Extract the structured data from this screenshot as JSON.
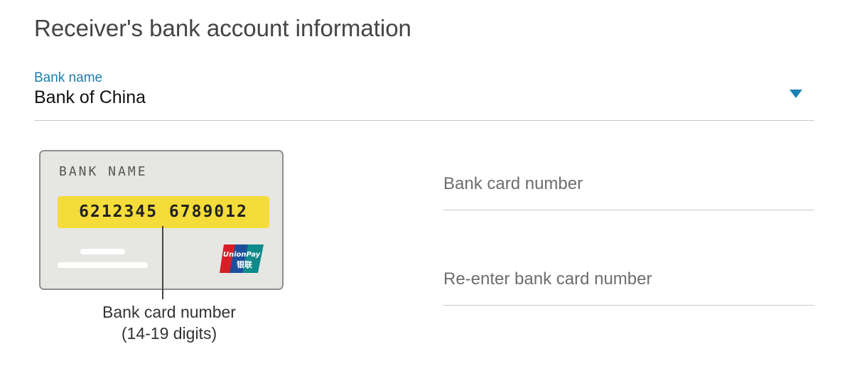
{
  "page": {
    "title": "Receiver's bank account information"
  },
  "bank_select": {
    "label": "Bank name",
    "value": "Bank of China",
    "caret_icon": "triangle-down-icon",
    "accent_color": "#1a82b5"
  },
  "card_illustration": {
    "bank_name": "BANK NAME",
    "card_number": "6212345 6789012",
    "band_color": "#f4dc3a",
    "logo_name": "unionpay-logo",
    "logo_text_top": "UnionPay",
    "logo_text_bottom": "银联",
    "caption_line1": "Bank card number",
    "caption_line2": "(14-19 digits)"
  },
  "form": {
    "card_number_placeholder": "Bank card number",
    "reenter_placeholder": "Re-enter bank card number"
  }
}
